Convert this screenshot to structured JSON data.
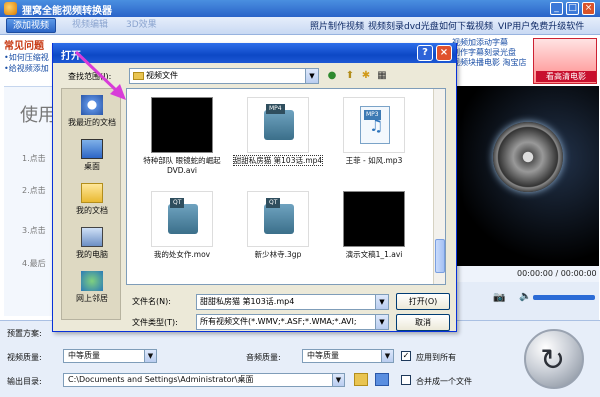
{
  "app": {
    "title": "狸窝全能视频转换器",
    "toolbar": {
      "add_video": "添加视频",
      "dim_1": "视频编辑",
      "dim_2": "3D效果",
      "links": [
        "照片制作视频",
        "视频刻录dvd光盘",
        "如何下载视频",
        "VIP用户免费升级软件"
      ]
    },
    "faq": {
      "title": "常见问题",
      "items": [
        "•如何压缩视",
        "•给视频添加"
      ]
    },
    "usage": {
      "title": "使用",
      "steps": [
        "1.点击",
        "2.点击",
        "3.点击",
        "4.最后"
      ]
    },
    "promo": {
      "links": [
        "视频加添动字幕",
        "制作字幕刻录光盘",
        "视频块播电影 淘宝店"
      ],
      "banner": "看高清电影"
    },
    "player": {
      "time": "00:00:00 / 00:00:00"
    },
    "settings": {
      "preset_label": "预置方案:",
      "video_quality_label": "视频质量:",
      "video_quality": "中等质量",
      "audio_quality_label": "音频质量:",
      "audio_quality": "中等质量",
      "apply_all": "应用到所有",
      "output_label": "输出目录:",
      "output_path": "C:\\Documents and Settings\\Administrator\\桌面",
      "merge": "合并成一个文件"
    }
  },
  "dialog": {
    "title": "打开",
    "lookin_label": "查找范围(I):",
    "lookin_value": "视频文件",
    "places": [
      "我最近的文档",
      "桌面",
      "我的文档",
      "我的电脑",
      "网上邻居"
    ],
    "files": [
      {
        "name": "特种部队 眼镜蛇的崛起DVD.avi",
        "thumb": "black"
      },
      {
        "name": "甜甜私房猫 第103话.mp4",
        "thumb": "mp4",
        "tag": "MP4"
      },
      {
        "name": "王菲 - 如风.mp3",
        "thumb": "mp3",
        "tag": "MP3"
      },
      {
        "name": "我的处女作.mov",
        "thumb": "qt",
        "tag": "QT"
      },
      {
        "name": "新少林寺.3gp",
        "thumb": "qt",
        "tag": "QT"
      },
      {
        "name": "演示文稿1_1.avi",
        "thumb": "black"
      }
    ],
    "filename_label": "文件名(N):",
    "filename_value": "甜甜私房猫 第103话.mp4",
    "filetype_label": "文件类型(T):",
    "filetype_value": "所有视频文件(*.WMV;*.ASF;*.WMA;*.AVI;",
    "open_btn": "打开(O)",
    "cancel_btn": "取消"
  },
  "colors": {
    "titlebar": "#0d48c5",
    "arrow": "#d83cd8",
    "faq_title": "#c83a14"
  }
}
